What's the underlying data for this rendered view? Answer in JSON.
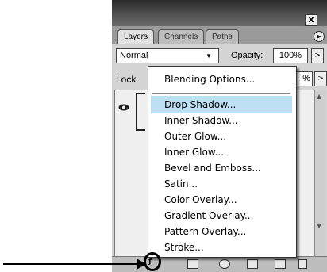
{
  "panel": {
    "close_glyph": "x",
    "tabs": [
      "Layers",
      "Channels",
      "Paths"
    ],
    "blend_mode": "Normal",
    "opacity_label": "Opacity:",
    "opacity_value": "100%",
    "lock_label": "Lock",
    "fill_value": "%"
  },
  "menu": {
    "items": [
      "Blending Options...",
      "Drop Shadow...",
      "Inner Shadow...",
      "Outer Glow...",
      "Inner Glow...",
      "Bevel and Emboss...",
      "Satin...",
      "Color Overlay...",
      "Gradient Overlay...",
      "Pattern Overlay...",
      "Stroke..."
    ],
    "highlighted_index": 1,
    "highlight_color": "#bde0f3"
  },
  "icons": [
    "eye-icon",
    "fx-icon",
    "mask-icon",
    "adjustment-icon",
    "folder-icon",
    "new-layer-icon",
    "trash-icon"
  ]
}
